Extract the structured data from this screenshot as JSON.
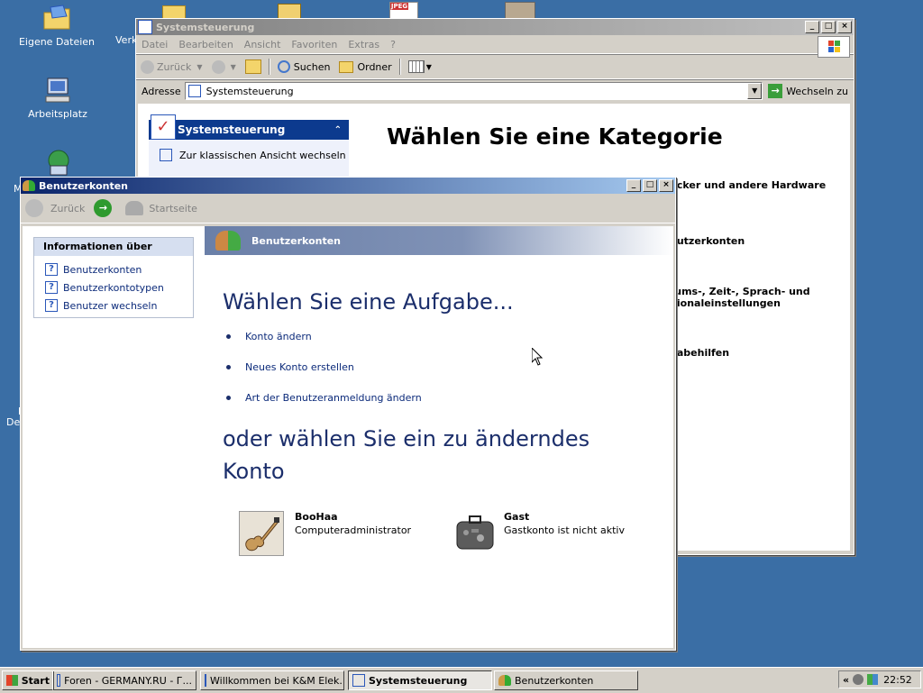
{
  "desktop": {
    "icons": [
      {
        "label": "Eigene Dateien"
      },
      {
        "label": "Verk"
      },
      {
        "label": "Arbeitsplatz"
      },
      {
        "label": "M"
      },
      {
        "label": "l"
      },
      {
        "label": "Des"
      }
    ]
  },
  "control_panel": {
    "title": "Systemsteuerung",
    "menu": [
      "Datei",
      "Bearbeiten",
      "Ansicht",
      "Favoriten",
      "Extras",
      "?"
    ],
    "toolbar": {
      "back": "Zurück",
      "search": "Suchen",
      "folders": "Ordner"
    },
    "address_label": "Adresse",
    "address_value": "Systemsteuerung",
    "go_label": "Wechseln zu",
    "side_panel_title": "Systemsteuerung",
    "side_link": "Zur klassischen Ansicht wechseln",
    "heading": "Wählen Sie eine Kategorie",
    "categories": [
      "ucker und andere Hardware",
      "nutzerkonten",
      "tums-, Zeit-, Sprach- und",
      "gionaleinstellungen",
      "gabehilfen"
    ]
  },
  "user_accounts": {
    "title": "Benutzerkonten",
    "toolbar": {
      "back": "Zurück",
      "home": "Startseite"
    },
    "info_title": "Informationen über",
    "info_links": [
      "Benutzerkonten",
      "Benutzerkontotypen",
      "Benutzer wechseln"
    ],
    "banner": "Benutzerkonten",
    "task_heading": "Wählen Sie eine Aufgabe...",
    "tasks": [
      "Konto ändern",
      "Neues Konto erstellen",
      "Art der Benutzeranmeldung ändern"
    ],
    "account_heading_1": "oder wählen Sie ein zu änderndes",
    "account_heading_2": "Konto",
    "accounts": [
      {
        "name": "BooHaa",
        "type": "Computeradministrator"
      },
      {
        "name": "Gast",
        "type": "Gastkonto ist nicht aktiv"
      }
    ]
  },
  "taskbar": {
    "start": "Start",
    "buttons": [
      "Foren - GERMANY.RU - Г...",
      "Willkommen bei K&M Elek...",
      "Systemsteuerung",
      "Benutzerkonten"
    ],
    "tray_arrow": "«",
    "time": "22:52"
  },
  "colors": {
    "desktop": "#3a6ea5",
    "title_active": "#0a246a",
    "link": "#0b2a7a",
    "heading": "#1b2e6b"
  }
}
